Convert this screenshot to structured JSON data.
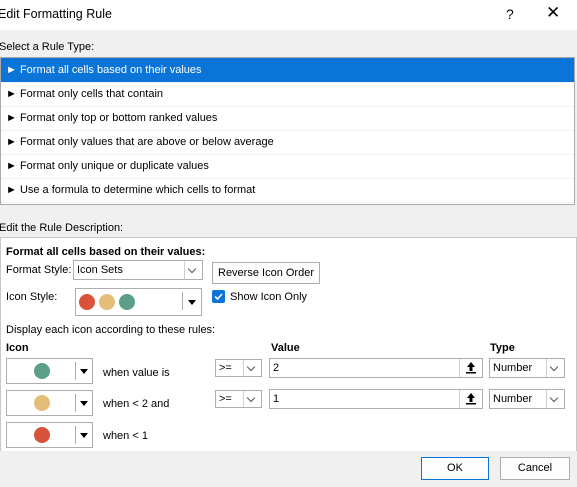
{
  "window": {
    "title": "Edit Formatting Rule",
    "help_label": "?",
    "close_label": "✕"
  },
  "rule_type": {
    "label": "Select a Rule Type:",
    "items": [
      {
        "label": "► Format all cells based on their values",
        "selected": true
      },
      {
        "label": "► Format only cells that contain",
        "selected": false
      },
      {
        "label": "► Format only top or bottom ranked values",
        "selected": false
      },
      {
        "label": "► Format only values that are above or below average",
        "selected": false
      },
      {
        "label": "► Format only unique or duplicate values",
        "selected": false
      },
      {
        "label": "► Use a formula to determine which cells to format",
        "selected": false
      }
    ]
  },
  "description": {
    "label": "Edit the Rule Description:",
    "heading": "Format all cells based on their values:",
    "format_style_label": "Format Style:",
    "format_style_value": "Icon Sets",
    "reverse_icon_order": "Reverse Icon Order",
    "icon_style_label": "Icon Style:",
    "icon_style_colors": [
      "#d9533b",
      "#e5bd78",
      "#5b9f86"
    ],
    "show_icon_only_label": "Show Icon Only",
    "show_icon_only_checked": true,
    "display_rules_label": "Display each icon according to these rules:",
    "columns": {
      "icon": "Icon",
      "value": "Value",
      "type": "Type"
    },
    "rules": [
      {
        "icon_color": "#5b9f86",
        "condition": "when value is",
        "operator": ">=",
        "value": "2",
        "type": "Number"
      },
      {
        "icon_color": "#e5bd78",
        "condition": "when < 2 and",
        "operator": ">=",
        "value": "1",
        "type": "Number"
      },
      {
        "icon_color": "#d9533b",
        "condition": "when < 1"
      }
    ]
  },
  "footer": {
    "ok": "OK",
    "cancel": "Cancel"
  },
  "colors": {
    "selection": "#0a74d8",
    "checkbox": "#0a74d8",
    "ok_border": "#0a74d8"
  }
}
